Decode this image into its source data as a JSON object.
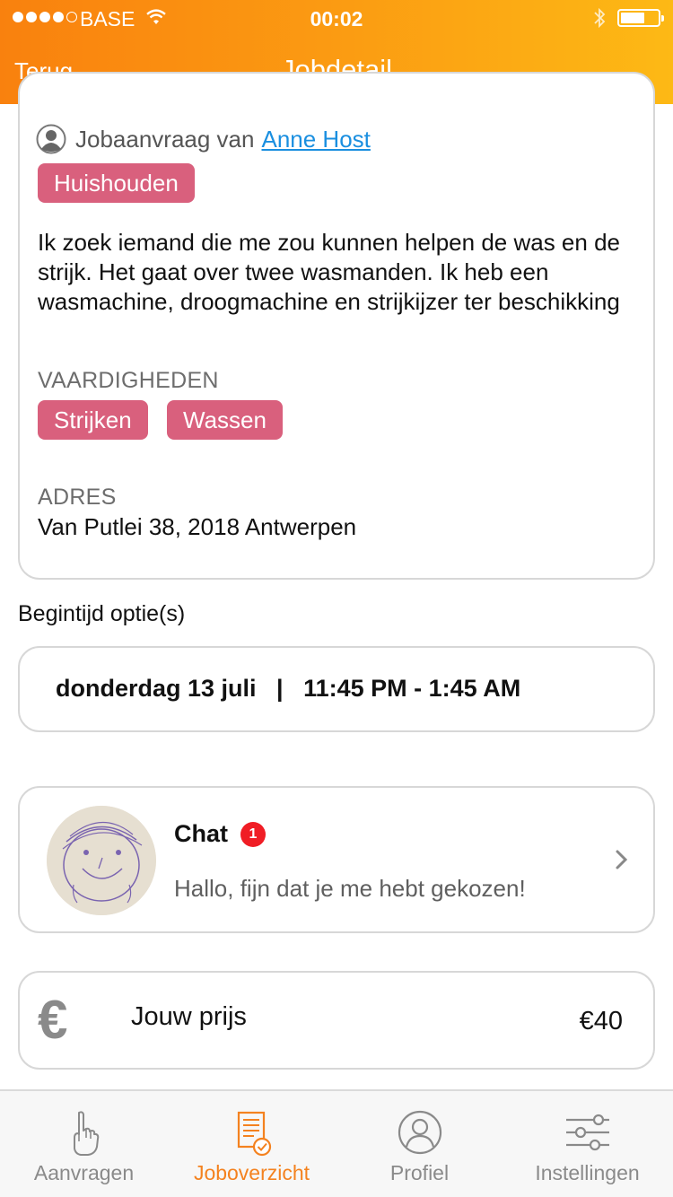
{
  "status_bar": {
    "carrier": "BASE",
    "time": "00:02"
  },
  "nav": {
    "back_label": "Terug",
    "title": "Jobdetail"
  },
  "job": {
    "requester_prefix": "Jobaanvraag van",
    "requester_name": "Anne Host",
    "category": "Huishouden",
    "description": "Ik zoek iemand die me zou kunnen helpen de was en de strijk. Het gaat over twee wasmanden. Ik heb een wasmachine, droogmachine en strijkijzer ter beschikking",
    "skills_label": "VAARDIGHEDEN",
    "skills": [
      "Strijken",
      "Wassen"
    ],
    "address_label": "ADRES",
    "address": "Van Putlei  38, 2018 Antwerpen"
  },
  "start_time": {
    "label": "Begintijd optie(s)",
    "option": "donderdag 13 juli   |   11:45 PM - 1:45 AM"
  },
  "chat": {
    "title": "Chat",
    "unread_count": "1",
    "last_message": "Hallo, fijn dat je me hebt gekozen!"
  },
  "price": {
    "icon": "euro-icon",
    "label": "Jouw prijs",
    "value": "€40"
  },
  "tabs": [
    {
      "label": "Aanvragen",
      "icon": "hand-icon",
      "active": false
    },
    {
      "label": "Joboverzicht",
      "icon": "document-check-icon",
      "active": true
    },
    {
      "label": "Profiel",
      "icon": "profile-icon",
      "active": false
    },
    {
      "label": "Instellingen",
      "icon": "sliders-icon",
      "active": false
    }
  ],
  "colors": {
    "header_start": "#f9810e",
    "header_end": "#fdb915",
    "tag": "#d9607d",
    "link": "#1a8fe0",
    "badge": "#f01d25",
    "tab_active": "#f4821f"
  }
}
